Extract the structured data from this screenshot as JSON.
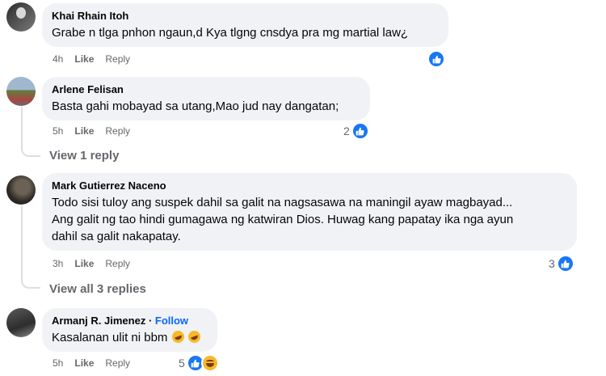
{
  "comments": [
    {
      "author": "Khai Rhain Itoh",
      "text": "Grabe n tlga pnhon ngaun,d Kya tlgng cnsdya pra mg martial law¿",
      "time": "4h",
      "like_label": "Like",
      "reply_label": "Reply",
      "reaction_count": ""
    },
    {
      "author": "Arlene Felisan",
      "text": "Basta gahi mobayad sa utang,Mao jud nay dangatan;",
      "time": "5h",
      "like_label": "Like",
      "reply_label": "Reply",
      "reaction_count": "2",
      "view_replies": "View 1 reply"
    },
    {
      "author": "Mark Gutierrez Naceno",
      "text_lines": [
        "Todo sisi tuloy ang suspek dahil sa galit na nagsasawa na maningil ayaw magbayad...",
        "Ang galit ng tao hindi gumagawa ng katwiran Dios. Huwag kang papatay ika nga ayun",
        "dahil sa galit nakapatay."
      ],
      "time": "3h",
      "like_label": "Like",
      "reply_label": "Reply",
      "reaction_count": "3",
      "view_replies": "View all 3 replies"
    },
    {
      "author": "Armanj R. Jimenez",
      "separator": " · ",
      "follow_label": "Follow",
      "text": "Kasalanan ulit ni bbm",
      "time": "5h",
      "like_label": "Like",
      "reply_label": "Reply",
      "reaction_count": "5"
    }
  ],
  "colors": {
    "bubble": "#f0f2f5",
    "meta_text": "#65676b",
    "like_blue": "#1877f2",
    "follow_blue": "#0866ff",
    "haha_yellow": "#f7b928"
  },
  "icons": [
    "like-reaction-icon",
    "haha-reaction-icon",
    "laughing-emoji-icon"
  ]
}
